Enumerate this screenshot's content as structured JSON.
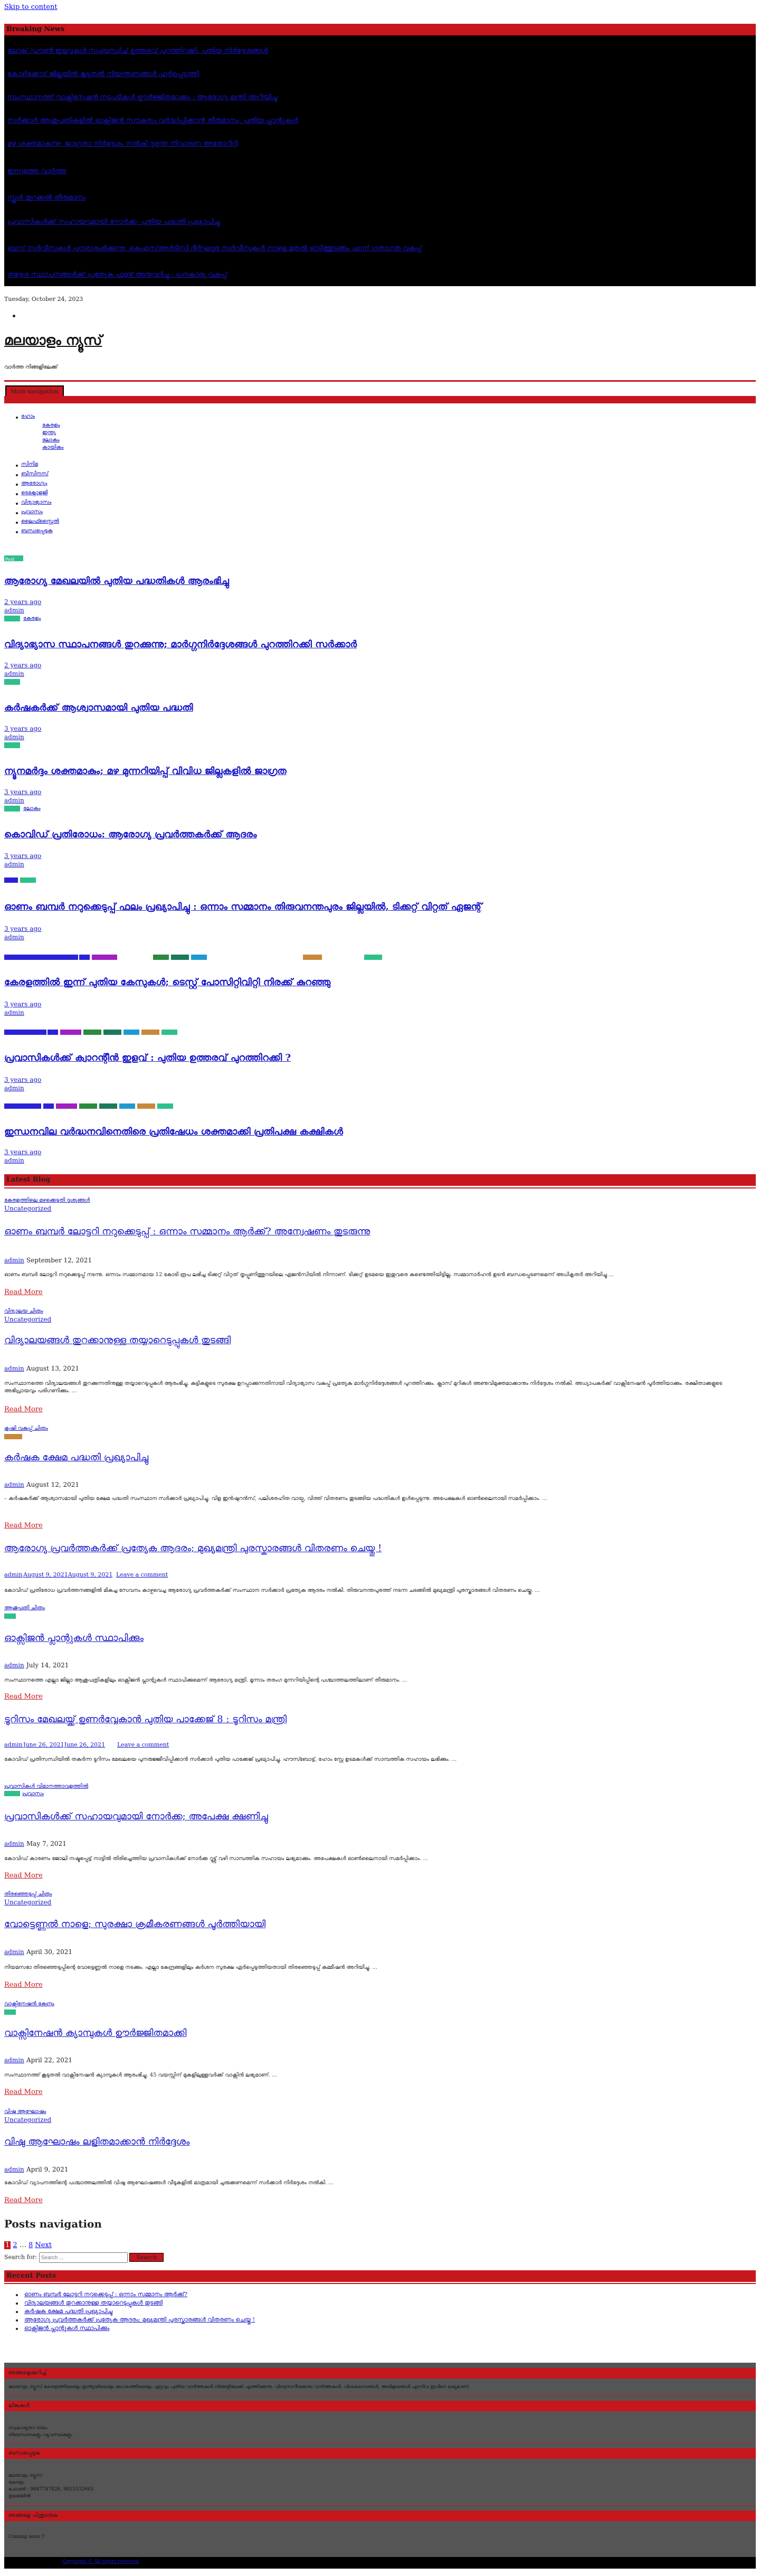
{
  "skip_link": "Skip to content",
  "breaking": {
    "title": "Breaking News",
    "items": [
      "ലോക് ഡൗൺ ഇളവുകൾ സംബന്ധിച്ച് ഉത്തരവ് പുറത്തിറക്കി; പുതിയ നിർദ്ദേശങ്ങൾ",
      "കോഴിക്കോട് ജില്ലയിൽ കൂടുതൽ നിയന്ത്രണങ്ങൾ ഏർപ്പെടുത്തി",
      "സംസ്ഥാനത്ത് വാക്സിനേഷൻ നടപടികൾ ഊർജ്ജിതമാക്കും : ആരോഗ്യ മന്ത്രി അറിയിച്ചു",
      "സർക്കാർ ആശുപത്രികളിൽ ഓക്സിജൻ സൗകര്യം വർദ്ധിപ്പിക്കാൻ തീരുമാനം; പുതിയ പ്ലാന്റുകൾ",
      "മഴ ശക്തമാകുന്നു; ജാഗ്രതാ നിർദ്ദേശം നൽകി ദുരന്ത നിവാരണ അതോറിറ്റി",
      "ഇന്നത്തെ വാർത്ത",
      "സ്കൂൾ തുറക്കൽ തീരുമാനം",
      "പ്രവാസികൾക്ക് സഹായവുമായി നോർക്ക; പുതിയ പദ്ധതി പ്രഖ്യാപിച്ചു",
      "ബസ് സർവീസുകൾ പുനരാരംഭിക്കുന്നു; കെഎസ്ആർടിസി ദീർഘദൂര സർവീസുകൾ നാളെ മുതൽ ഓടിത്തുടങ്ങും എന്ന് ഗതാഗത വകുപ്പ്",
      "തദ്ദേശ സ്ഥാപനങ്ങൾക്ക് പ്രത്യേക ഫണ്ട് അനുവദിച്ചു : ധനകാര്യ വകുപ്പ്"
    ]
  },
  "date": "Tuesday, October 24, 2023",
  "site": {
    "title": "മലയാളം ന്യൂസ്",
    "tagline": "വാർത്ത നിങ്ങളിലേക്ക്"
  },
  "nav": {
    "toggle_label": "Main navigation",
    "menu": [
      "ഹോം",
      "കേരളം",
      "ഇന്ത്യ",
      "ലോകം",
      "കായികം",
      "സിനിമ",
      "ബിസിനസ്",
      "ആരോഗ്യം",
      "ടെക്നോളജി",
      "വിദ്യാഭ്യാസം",
      "പ്രവാസം",
      "ലൈഫ്സ്റ്റൈൽ",
      "ബന്ധപ്പെടുക"
    ]
  },
  "featured_badge": "Post",
  "featured_posts": [
    {
      "title": "ആരോഗ്യ മേഖലയിൽ പുതിയ പദ്ധതികൾ ആരംഭിച്ചു",
      "time": "2 years ago",
      "author": "admin",
      "cats": [
        "കേരളം"
      ]
    },
    {
      "title": "വിദ്യാഭ്യാസ സ്ഥാപനങ്ങൾ തുറക്കുന്നു; മാർഗ്ഗനിർദ്ദേശങ്ങൾ പുറത്തിറക്കി സർക്കാർ",
      "time": "2 years ago",
      "author": "admin",
      "cats": []
    },
    {
      "title": "കർഷകർക്ക് ആശ്വാസമായി പുതിയ പദ്ധതി",
      "time": "3 years ago",
      "author": "admin",
      "cats": []
    },
    {
      "title": "ന്യൂനമർദ്ദം ശക്തമാകും; മഴ മുന്നറിയിപ്പ് വിവിധ ജില്ലകളിൽ ജാഗ്രത",
      "time": "3 years ago",
      "author": "admin",
      "cats": [
        "ലോകം"
      ]
    },
    {
      "title": "കൊവിഡ് പ്രതിരോധം: ആരോഗ്യ പ്രവർത്തകർക്ക് ആദരം",
      "time": "3 years ago",
      "author": "admin",
      "cats": []
    },
    {
      "title": "ഓണം ബമ്പർ നറുക്കെടുപ്പ് ഫലം പ്രഖ്യാപിച്ചു : ഒന്നാം സമ്മാനം തിരുവനന്തപുരം ജില്ലയിൽ, ടിക്കറ്റ് വിറ്റത് ഏജന്റ്",
      "time": "3 years ago",
      "author": "admin",
      "cats": []
    },
    {
      "title": "കേരളത്തിൽ ഇന്ന് പുതിയ കേസുകൾ; ടെസ്റ്റ് പോസിറ്റിവിറ്റി നിരക്ക് കുറഞ്ഞു",
      "time": "3 years ago",
      "author": "admin",
      "cats": []
    },
    {
      "title": "പ്രവാസികൾക്ക് ക്വാറന്റീൻ ഇളവ് : പുതിയ ഉത്തരവ് പുറത്തിറക്കി ?",
      "time": "3 years ago",
      "author": "admin",
      "cats": []
    },
    {
      "title": "ഇന്ധനവില വർദ്ധനവിനെതിരെ പ്രതിഷേധം ശക്തമാക്കി പ്രതിപക്ഷ കക്ഷികൾ",
      "time": "3 years ago",
      "author": "admin",
      "cats": []
    }
  ],
  "latest": {
    "title": "Latest Blog",
    "posts": [
      {
        "img_alt": "കേരളത്തിലെ മഴക്കെടുതി ദൃശ്യങ്ങൾ",
        "cat": "Uncategorized",
        "title": "ഓണം ബമ്പർ ലോട്ടറി നറുക്കെടുപ്പ് : ഒന്നാം സമ്മാനം ആർക്ക്? അന്വേഷണം തുടരുന്നു",
        "author": "admin",
        "date": "September 12, 2021",
        "excerpt": "ഓണം ബമ്പർ ലോട്ടറി നറുക്കെടുപ്പ് നടന്നു. ഒന്നാം സമ്മാനമായ 12 കോടി രൂപ ലഭിച്ച ടിക്കറ്റ് വിറ്റത് തൃപ്പൂണിത്തുറയിലെ ഏജൻസിയിൽ നിന്നാണ്. ടിക്കറ്റ് ഉടമയെ ഇതുവരെ കണ്ടെത്തിയിട്ടില്ല. സമ്മാനാർഹൻ ഉടൻ ബന്ധപ്പെടണമെന്ന് അധികൃതർ അറിയിച്ചു ...",
        "read_more": "Read More"
      },
      {
        "img_alt": "വിദ്യാലയ ചിത്രം",
        "cat": "Uncategorized",
        "title": "വിദ്യാലയങ്ങൾ തുറക്കാനുള്ള തയ്യാറെടുപ്പുകൾ തുടങ്ങി",
        "author": "admin",
        "date": "August 13, 2021",
        "excerpt": "സംസ്ഥാനത്തെ വിദ്യാലയങ്ങൾ തുറക്കുന്നതിനുള്ള തയ്യാറെടുപ്പുകൾ ആരംഭിച്ചു. കുട്ടികളുടെ സുരക്ഷ ഉറപ്പാക്കുന്നതിനായി വിദ്യാഭ്യാസ വകുപ്പ് പ്രത്യേക മാർഗ്ഗനിർദ്ദേശങ്ങൾ പുറത്തിറക്കും. ക്ലാസ് മുറികൾ അണുവിമുക്തമാക്കാനും നിർദ്ദേശം നൽകി. അധ്യാപകർക്ക് വാക്സിനേഷൻ പൂർത്തിയാക്കും. രക്ഷിതാക്കളുടെ അഭിപ്രായവും പരിഗണിക്കും. ...",
        "read_more": "Read More"
      },
      {
        "img_alt": "കൃഷി വകുപ്പ് ചിത്രം",
        "cat": "കായികം",
        "title": "കർഷക ക്ഷേമ പദ്ധതി പ്രഖ്യാപിച്ചു",
        "author": "admin",
        "date": "August 12, 2021",
        "excerpt": "– കർഷകർക്ക് ആശ്വാസമായി പുതിയ ക്ഷേമ പദ്ധതി സംസ്ഥാന സർക്കാർ പ്രഖ്യാപിച്ചു. വിള ഇൻഷുറൻസ്, പലിശരഹിത വായ്പ, വിത്ത് വിതരണം തുടങ്ങിയ പദ്ധതികൾ ഉൾപ്പെടുന്നു. അപേക്ഷകൾ ഓൺലൈനായി സമർപ്പിക്കാം. ...",
        "read_more": "Read More"
      },
      {
        "img_alt": "",
        "cat": "",
        "title": "ആരോഗ്യ പ്രവർത്തകർക്ക് പ്രത്യേക ആദരം; മുഖ്യമന്ത്രി പുരസ്കാരങ്ങൾ വിതരണം ചെയ്തു !",
        "author": "admin",
        "date": "August 9, 2021August 9, 2021",
        "comment": "Leave a comment",
        "excerpt": "കോവിഡ് പ്രതിരോധ പ്രവർത്തനങ്ങളിൽ മികച്ച സേവനം കാഴ്ചവെച്ച ആരോഗ്യ പ്രവർത്തകർക്ക് സംസ്ഥാന സർക്കാർ പ്രത്യേക ആദരം നൽകി. തിരുവനന്തപുരത്ത് നടന്ന ചടങ്ങിൽ മുഖ്യമന്ത്രി പുരസ്കാരങ്ങൾ വിതരണം ചെയ്തു. ...",
        "read_more": ""
      },
      {
        "img_alt": "ആശുപത്രി ചിത്രം",
        "cat": "കേരളം",
        "title": "ഓക്സിജൻ പ്ലാന്റുകൾ സ്ഥാപിക്കും",
        "author": "admin",
        "date": "July 14, 2021",
        "excerpt": "സംസ്ഥാനത്തെ എല്ലാ ജില്ലാ ആശുപത്രികളിലും ഓക്സിജൻ പ്ലാന്റുകൾ സ്ഥാപിക്കുമെന്ന് ആരോഗ്യ മന്ത്രി. മൂന്നാം തരംഗ മുന്നറിയിപ്പിന്റെ പശ്ചാത്തലത്തിലാണ് തീരുമാനം. ...",
        "read_more": "Read More"
      },
      {
        "img_alt": "",
        "cat": "",
        "title": "ടൂറിസം മേഖലയ്ക്ക് ഉണർവ്വേകാൻ പുതിയ പാക്കേജ് 8 : ടൂറിസം മന്ത്രി",
        "author": "admin",
        "date": "June 26, 2021June 26, 2021",
        "comment": "Leave a comment",
        "excerpt": "കോവിഡ് പ്രതിസന്ധിയിൽ തകർന്ന ടൂറിസം മേഖലയെ പുനരുജ്ജീവിപ്പിക്കാൻ സർക്കാർ പുതിയ പാക്കേജ് പ്രഖ്യാപിച്ചു. ഹൗസ്ബോട്ട്, ഹോം സ്റ്റേ ഉടമകൾക്ക് സാമ്പത്തിക സഹായം ലഭിക്കും. ...",
        "read_more": ""
      },
      {
        "img_alt": "പ്രവാസികൾ വിമാനത്താവളത്തിൽ",
        "cat": "പ്രവാസം",
        "title": "പ്രവാസികൾക്ക് സഹായവുമായി നോർക്ക; അപേക്ഷ ക്ഷണിച്ചു",
        "author": "admin",
        "date": "May 7, 2021",
        "excerpt": "കോവിഡ് കാരണം ജോലി നഷ്ടപ്പെട്ട് നാട്ടിൽ തിരിച്ചെത്തിയ പ്രവാസികൾക്ക് നോർക്ക റൂട്ട്സ് വഴി സാമ്പത്തിക സഹായം ലഭ്യമാക്കും. അപേക്ഷകൾ ഓൺലൈനായി സമർപ്പിക്കാം. ...",
        "read_more": "Read More"
      },
      {
        "img_alt": "തിരഞ്ഞെടുപ്പ് ചിത്രം",
        "cat": "Uncategorized",
        "title": "വോട്ടെണ്ണൽ നാളെ; സുരക്ഷാ ക്രമീകരണങ്ങൾ പൂർത്തിയായി",
        "author": "admin",
        "date": "April 30, 2021",
        "excerpt": "നിയമസഭാ തിരഞ്ഞെടുപ്പിന്റെ വോട്ടെണ്ണൽ നാളെ നടക്കും. എല്ലാ കേന്ദ്രങ്ങളിലും കർശന സുരക്ഷ ഏർപ്പെടുത്തിയതായി തിരഞ്ഞെടുപ്പ് കമ്മീഷൻ അറിയിച്ചു. ...",
        "read_more": "Read More"
      },
      {
        "img_alt": "വാക്സിനേഷൻ കേന്ദ്രം",
        "cat": "ആരോഗ്യം",
        "title": "വാക്സിനേഷൻ ക്യാമ്പുകൾ ഊർജ്ജിതമാക്കി",
        "author": "admin",
        "date": "April 22, 2021",
        "excerpt": "സംസ്ഥാനത്ത് കൂടുതൽ വാക്സിനേഷൻ ക്യാമ്പുകൾ ആരംഭിച്ചു. 45 വയസ്സിന് മുകളിലുള്ളവർക്ക് വാക്സിൻ ലഭ്യമാണ്. ...",
        "read_more": "Read More"
      },
      {
        "img_alt": "വിഷു ആഘോഷം",
        "cat": "Uncategorized",
        "title": "വിഷു ആഘോഷം ലളിതമാക്കാൻ നിർദ്ദേശം",
        "author": "admin",
        "date": "April 9, 2021",
        "excerpt": "കോവിഡ് വ്യാപനത്തിന്റെ പശ്ചാത്തലത്തിൽ വിഷു ആഘോഷങ്ങൾ വീടുകളിൽ മാത്രമായി ചുരുക്കണമെന്ന് സർക്കാർ നിർദ്ദേശം നൽകി. ...",
        "read_more": "Read More"
      }
    ]
  },
  "posts_nav": {
    "title": "Posts navigation",
    "current": "1",
    "pages": [
      "2",
      "…",
      "8"
    ],
    "next": "Next"
  },
  "search": {
    "label": "Search for:",
    "placeholder": "Search ...",
    "button": "Search"
  },
  "recent": {
    "title": "Recent Posts",
    "items": [
      "ഓണം ബമ്പർ ലോട്ടറി നറുക്കെടുപ്പ് : ഒന്നാം സമ്മാനം ആർക്ക്?",
      "വിദ്യാലയങ്ങൾ തുറക്കാനുള്ള തയ്യാറെടുപ്പുകൾ തുടങ്ങി",
      "കർഷക ക്ഷേമ പദ്ധതി പ്രഖ്യാപിച്ചു",
      "ആരോഗ്യ പ്രവർത്തകർക്ക് പ്രത്യേക ആദരം; മുഖ്യമന്ത്രി പുരസ്കാരങ്ങൾ വിതരണം ചെയ്തു !",
      "ഓക്സിജൻ പ്ലാന്റുകൾ സ്ഥാപിക്കും"
    ]
  },
  "footer": {
    "about_title": "ഞങ്ങളെക്കുറിച്ച്",
    "about_text": "മലയാളം ന്യൂസ് കേരളത്തിലെയും ഇന്ത്യയിലെയും ലോകത്തിലെയും ഏറ്റവും പുതിയ വാർത്തകൾ നിങ്ങളിലേക്ക് എത്തിക്കുന്നു. വിശ്വസനീയമായ വാർത്തകൾ, വിശകലനങ്ങൾ, അഭിമുഖങ്ങൾ എന്നിവ ഇവിടെ ലഭ്യമാണ്.",
    "links_title": "ലിങ്കുകൾ",
    "links": [
      "സ്വകാര്യതാ നയം",
      "നിബന്ധനകളും വ്യവസ്ഥകളും"
    ],
    "contact_title": "ബന്ധപ്പെടുക",
    "contact_lines": [
      "മലയാളം ന്യൂസ്",
      "കേരളം",
      "ഫോൺ : 9847747826, 9815532663",
      "ഇമെയിൽ"
    ],
    "follow_title": "ഞങ്ങളെ പിന്തുടരുക",
    "follow_text": "Coming soon !!",
    "bottom_link": "Copyright © All rights reserved"
  }
}
